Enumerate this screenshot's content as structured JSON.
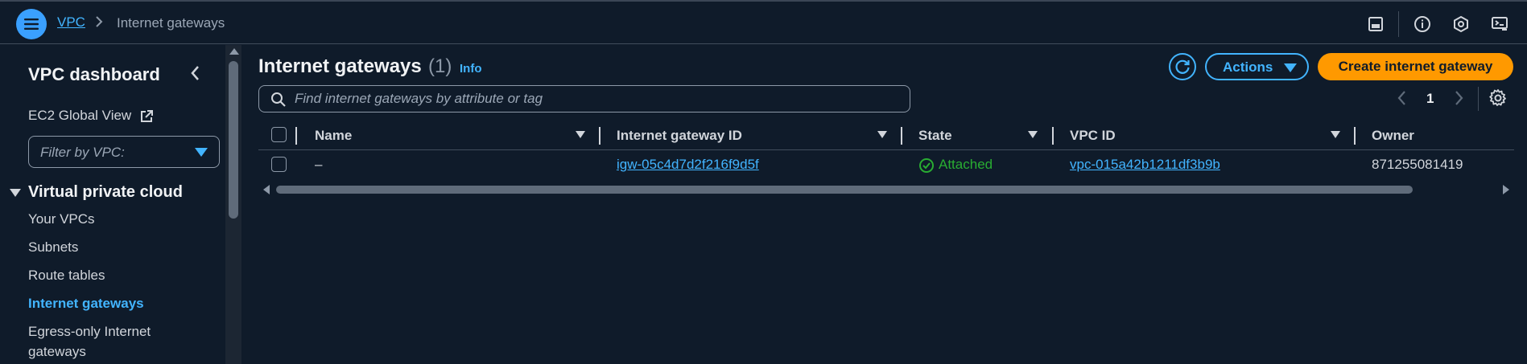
{
  "breadcrumb": {
    "root": "VPC",
    "separator": ">",
    "current": "Internet gateways"
  },
  "topbar_icons": [
    "panel-icon",
    "info-icon",
    "notifications-icon",
    "cloudshell-icon"
  ],
  "sidebar": {
    "title": "VPC dashboard",
    "ec2_global_view": "EC2 Global View",
    "filter_placeholder": "Filter by VPC:",
    "section_title": "Virtual private cloud",
    "items": [
      {
        "label": "Your VPCs",
        "active": false
      },
      {
        "label": "Subnets",
        "active": false
      },
      {
        "label": "Route tables",
        "active": false
      },
      {
        "label": "Internet gateways",
        "active": true
      },
      {
        "label": "Egress-only Internet",
        "active": false
      },
      {
        "label": "gateways",
        "active": false
      }
    ]
  },
  "main": {
    "title": "Internet gateways",
    "count": "(1)",
    "info_link": "Info",
    "actions_label": "Actions",
    "create_label": "Create internet gateway",
    "search_placeholder": "Find internet gateways by attribute or tag",
    "page_number": "1"
  },
  "table": {
    "columns": [
      "Name",
      "Internet gateway ID",
      "State",
      "VPC ID",
      "Owner"
    ],
    "rows": [
      {
        "name": "–",
        "igw_id": "igw-05c4d7d2f216f9d5f",
        "state": "Attached",
        "vpc_id": "vpc-015a42b1211df3b9b",
        "owner": "871255081419"
      }
    ]
  },
  "colors": {
    "background": "#0f1b2a",
    "accent": "#42b4ff",
    "primary_button": "#ff9900",
    "success": "#29ad32"
  }
}
